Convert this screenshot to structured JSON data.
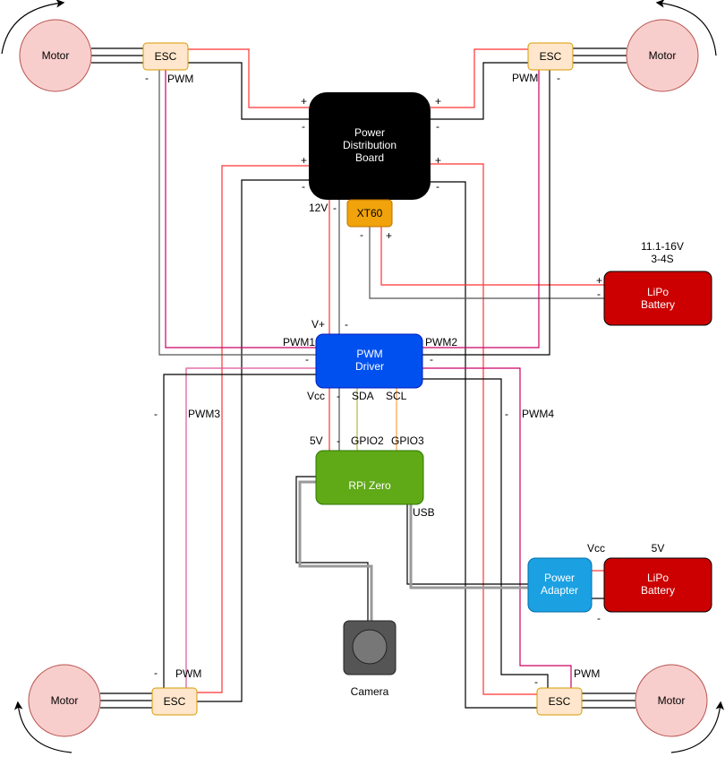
{
  "colors": {
    "power_positive": "#ff0000",
    "ground": "#000000",
    "pwm": "#cc0066",
    "sda": "#b5b54a",
    "scl": "#ffa040",
    "motor": "#f8cecc",
    "esc": "#ffe6cc",
    "pdb": "#000000",
    "xt60": "#f0a30a",
    "lipo": "#cc0000",
    "pwm_driver": "#0050ef",
    "rpi": "#60a917",
    "power_adapter": "#1ba1e2",
    "camera": "#555555"
  },
  "nodes": {
    "motor": "Motor",
    "esc": "ESC",
    "pdb": [
      "Power",
      "Distribution",
      "Board"
    ],
    "xt60": "XT60",
    "lipo_main": [
      "LiPo",
      "Battery"
    ],
    "lipo_main_spec": [
      "11.1-16V",
      "3-4S"
    ],
    "pwm_driver": [
      "PWM",
      "Driver"
    ],
    "rpi": "RPi Zero",
    "camera": "Camera",
    "power_adapter": [
      "Power",
      "Adapter"
    ],
    "lipo_aux": [
      "LiPo",
      "Battery"
    ],
    "lipo_aux_spec": "5V"
  },
  "labels": {
    "plus": "+",
    "minus": "-",
    "pwm": "PWM",
    "v12": "12V",
    "vplus": "V+",
    "pwm1": "PWM1",
    "pwm2": "PWM2",
    "pwm3": "PWM3",
    "pwm4": "PWM4",
    "vcc": "Vcc",
    "sda": "SDA",
    "scl": "SCL",
    "v5": "5V",
    "gpio2": "GPIO2",
    "gpio3": "GPIO3",
    "usb": "USB"
  },
  "icons": {
    "rotation": "curved-arrow",
    "camera": "camera-lens"
  }
}
